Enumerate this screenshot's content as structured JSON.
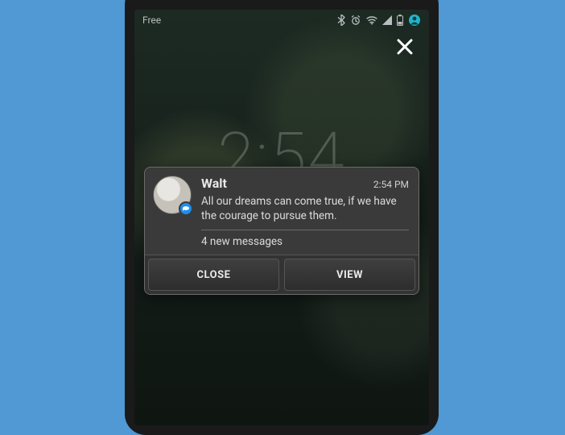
{
  "statusbar": {
    "left_label": "Free"
  },
  "lockscreen": {
    "clock": "2:54"
  },
  "notification": {
    "sender": "Walt",
    "time": "2:54 PM",
    "message": "All our dreams can come true, if we have the courage to pursue them.",
    "summary": "4 new messages",
    "buttons": {
      "close": "CLOSE",
      "view": "VIEW"
    }
  }
}
